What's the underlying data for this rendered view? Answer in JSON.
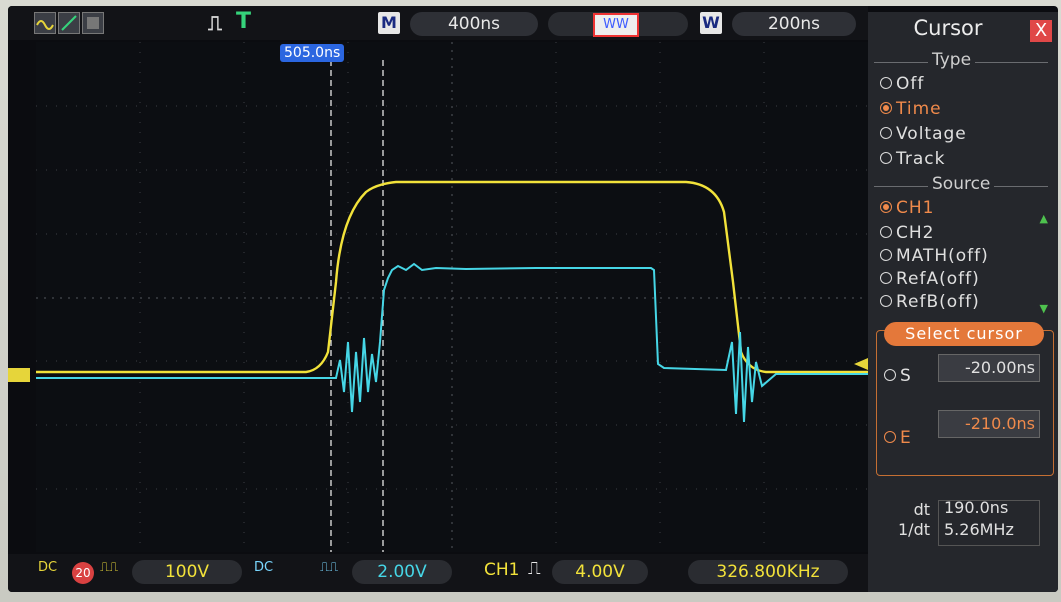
{
  "top_bar": {
    "trigger_symbol": "⎍",
    "trigger_status": "T",
    "m_label": "M",
    "timebase": "400ns",
    "w_label": "W",
    "window_timebase": "200ns"
  },
  "cursor_flag": "505.0ns",
  "panel": {
    "title": "Cursor",
    "close": "X",
    "type_label": "Type",
    "type_options": [
      "Off",
      "Time",
      "Voltage",
      "Track"
    ],
    "type_selected": "Time",
    "source_label": "Source",
    "source_options": [
      "CH1",
      "CH2",
      "MATH(off)",
      "RefA(off)",
      "RefB(off)"
    ],
    "source_selected": "CH1",
    "select_cursor_label": "Select cursor",
    "s_label": "S",
    "s_value": "-20.00ns",
    "e_label": "E",
    "e_value": "-210.0ns",
    "dt_label": "dt",
    "dt_value": "190.0ns",
    "inv_dt_label": "1/dt",
    "inv_dt_value": "5.26MHz"
  },
  "bottom_bar": {
    "ch1_coupling": "DC",
    "ch1_bw": "20",
    "ch1_scale": "100V",
    "ch2_coupling": "DC",
    "ch2_scale": "2.00V",
    "trigger_source": "CH1",
    "trigger_level": "4.00V",
    "frequency": "326.800KHz"
  },
  "colors": {
    "ch1": "#f2e23a",
    "ch2": "#46d6e6",
    "accent": "#e4783a",
    "cursor_flag": "#2b66e0"
  }
}
